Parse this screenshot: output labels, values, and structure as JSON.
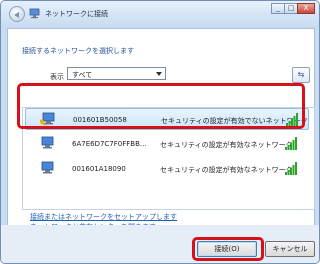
{
  "window": {
    "title": "ネットワークに接続",
    "controls": [
      "_",
      "□",
      "X"
    ]
  },
  "main": {
    "heading": "接続するネットワークを選択します",
    "filter_label": "表示",
    "filter_value": "すべて",
    "refresh_glyph": "⇆"
  },
  "networks": [
    {
      "ssid": "001601B50058",
      "security": "セキュリティの設定が有効でないネットワーク",
      "selected": true
    },
    {
      "ssid": "6A7E6D7C7F0FFBB...",
      "security": "セキュリティの設定が有効なネットワーク",
      "selected": false
    },
    {
      "ssid": "001601A18090",
      "security": "セキュリティの設定が有効なネットワーク",
      "selected": false
    }
  ],
  "links": {
    "setup": "接続またはネットワークをセットアップします",
    "center": "ネットワークと共有センターを開きます"
  },
  "buttons": {
    "connect": "接続(O)",
    "cancel": "キャンセル"
  },
  "colors": {
    "highlight": "#d8101a",
    "signal": "#2aa52a",
    "link": "#1e5db8"
  }
}
